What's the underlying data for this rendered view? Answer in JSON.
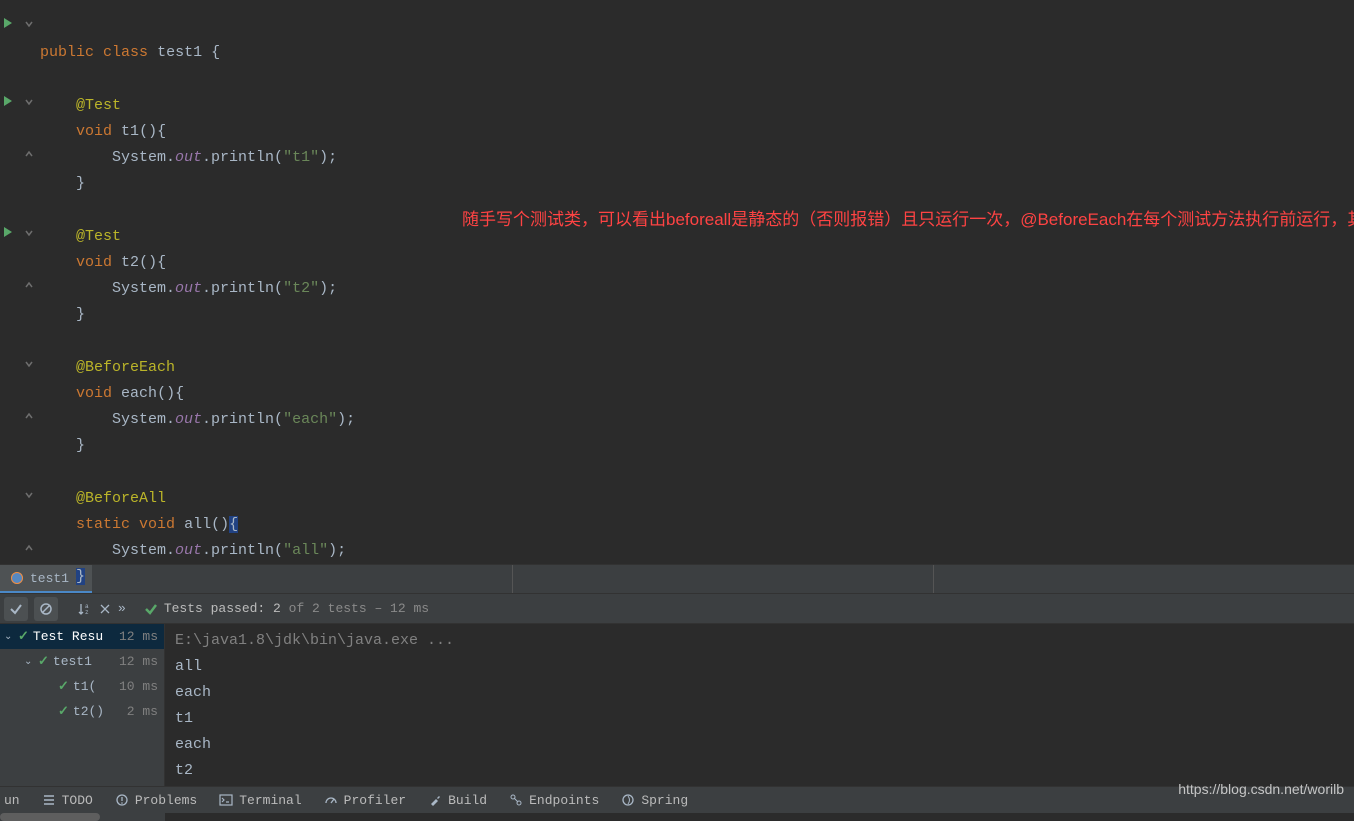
{
  "code": {
    "kw_public": "public",
    "kw_class": "class",
    "class_name": "test1",
    "open_brace": " {",
    "ann_test": "@Test",
    "kw_void": "void",
    "m_t1": "t1",
    "m_t2": "t2",
    "m_each": "each",
    "m_all": "all",
    "empty_parens": "(){",
    "sys": "System.",
    "out": "out",
    "println": ".println(",
    "str_t1": "\"t1\"",
    "str_t2": "\"t2\"",
    "str_each": "\"each\"",
    "str_all": "\"all\"",
    "close_stmt": ");",
    "close_brace": "}",
    "ann_beforeeach": "@BeforeEach",
    "ann_beforeall": "@BeforeAll",
    "kw_static": "static",
    "all_parens": "()",
    "all_brace": "{"
  },
  "annotation": "随手写个测试类，可以看出beforeall是静态的（否则报错）且只运行一次，@BeforeEach在每个测试方法执行前运行，其它注解不再赘述",
  "tab": {
    "name": "test1",
    "close": "×"
  },
  "toolbar": {
    "chevron": "»",
    "passed_label": "Tests passed: ",
    "passed_count": "2",
    "total_suffix": " of 2 tests – 12 ms"
  },
  "tree": {
    "root": "Test Resu",
    "root_time": "12 ms",
    "class": "test1",
    "class_time": "12 ms",
    "t1": "t1(",
    "t1_time": "10 ms",
    "t2": "t2()",
    "t2_time": "2 ms"
  },
  "console": {
    "cmd": "E:\\java1.8\\jdk\\bin\\java.exe ...",
    "l1": "all",
    "l2": "each",
    "l3": "t1",
    "l4": "each",
    "l5": "t2"
  },
  "bottom": {
    "run": "un",
    "todo": "TODO",
    "problems": "Problems",
    "terminal": "Terminal",
    "profiler": "Profiler",
    "build": "Build",
    "endpoints": "Endpoints",
    "spring": "Spring"
  },
  "watermark": "https://blog.csdn.net/worilb"
}
